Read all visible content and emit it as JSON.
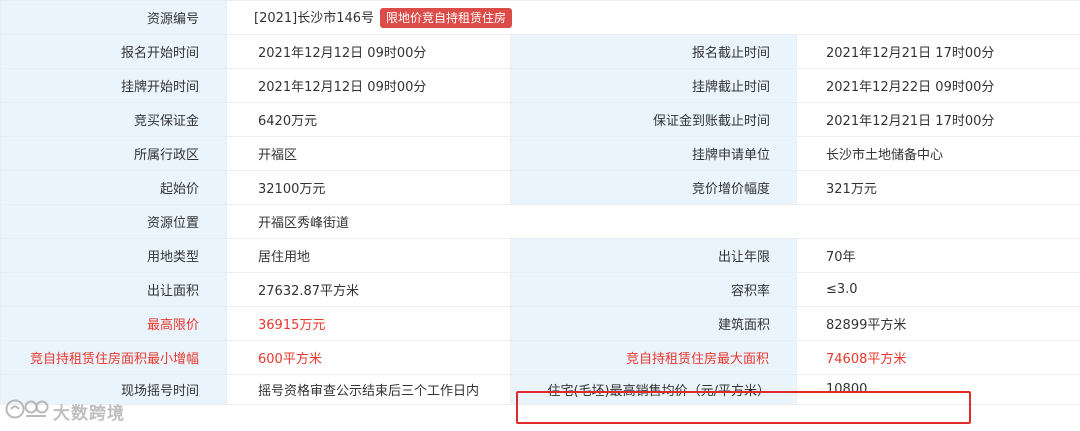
{
  "header": {
    "label": "资源编号",
    "value": "[2021]长沙市146号",
    "tag": "限地价竞自持租赁住房"
  },
  "rows": [
    {
      "l1": "报名开始时间",
      "v1": "2021年12月12日 09时00分",
      "l2": "报名截止时间",
      "v2": "2021年12月21日 17时00分"
    },
    {
      "l1": "挂牌开始时间",
      "v1": "2021年12月12日 09时00分",
      "l2": "挂牌截止时间",
      "v2": "2021年12月22日 09时00分"
    },
    {
      "l1": "竞买保证金",
      "v1": "6420万元",
      "l2": "保证金到账截止时间",
      "v2": "2021年12月21日 17时00分"
    },
    {
      "l1": "所属行政区",
      "v1": "开福区",
      "l2": "挂牌申请单位",
      "v2": "长沙市土地储备中心"
    },
    {
      "l1": "起始价",
      "v1": "32100万元",
      "l2": "竞价增价幅度",
      "v2": "321万元"
    },
    {
      "l1": "资源位置",
      "v1": "开福区秀峰街道"
    },
    {
      "l1": "用地类型",
      "v1": "居住用地",
      "l2": "出让年限",
      "v2": "70年"
    },
    {
      "l1": "出让面积",
      "v1": "27632.87平方米",
      "l2": "容积率",
      "v2": "≤3.0"
    },
    {
      "l1": "最高限价",
      "v1": "36915万元",
      "l2": "建筑面积",
      "v2": "82899平方米"
    },
    {
      "l1": "竞自持租赁住房面积最小增幅",
      "v1": "600平方米",
      "l2": "竞自持租赁住房最大面积",
      "v2": "74608平方米"
    },
    {
      "l1": "现场摇号时间",
      "v1": "摇号资格审查公示结束后三个工作日内",
      "l2": "住宅(毛坯)最高销售均价（元/平方米）",
      "v2": "10800"
    }
  ],
  "watermark": {
    "text": "大数跨境",
    "icon": "watermark-logo-icon"
  },
  "colors": {
    "label_bg": "#eaf4fc",
    "border": "#e9eef3",
    "highlight_red": "#e8382d",
    "tag_bg": "#db4b48",
    "box_border": "#e12b2b"
  }
}
